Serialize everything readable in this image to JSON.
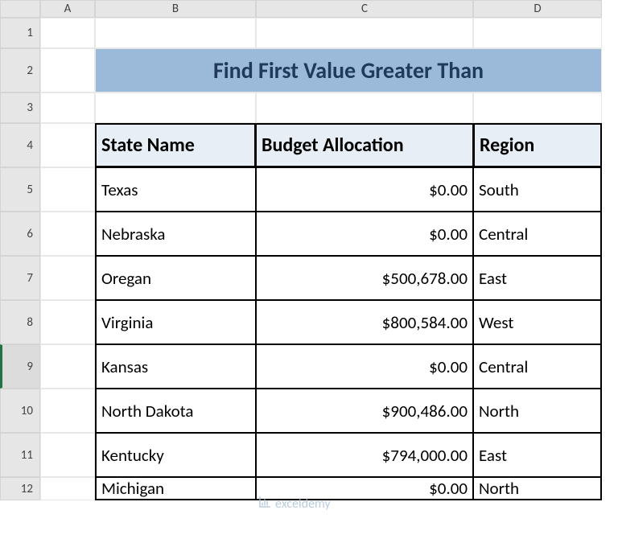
{
  "columns": [
    "A",
    "B",
    "C",
    "D"
  ],
  "rows": [
    "1",
    "2",
    "3",
    "4",
    "5",
    "6",
    "7",
    "8",
    "9",
    "10",
    "11",
    "12"
  ],
  "title": "Find First Value Greater Than",
  "headers": {
    "state": "State Name",
    "budget": "Budget Allocation",
    "region": "Region"
  },
  "data": [
    {
      "state": "Texas",
      "budget": "$0.00",
      "region": "South"
    },
    {
      "state": "Nebraska",
      "budget": "$0.00",
      "region": "Central"
    },
    {
      "state": "Oregan",
      "budget": "$500,678.00",
      "region": "East"
    },
    {
      "state": "Virginia",
      "budget": "$800,584.00",
      "region": "West"
    },
    {
      "state": "Kansas",
      "budget": "$0.00",
      "region": "Central"
    },
    {
      "state": "North Dakota",
      "budget": "$900,486.00",
      "region": "North"
    },
    {
      "state": "Kentucky",
      "budget": "$794,000.00",
      "region": "East"
    },
    {
      "state": "Michigan",
      "budget": "$0.00",
      "region": "North"
    }
  ],
  "watermark": "exceldemy"
}
